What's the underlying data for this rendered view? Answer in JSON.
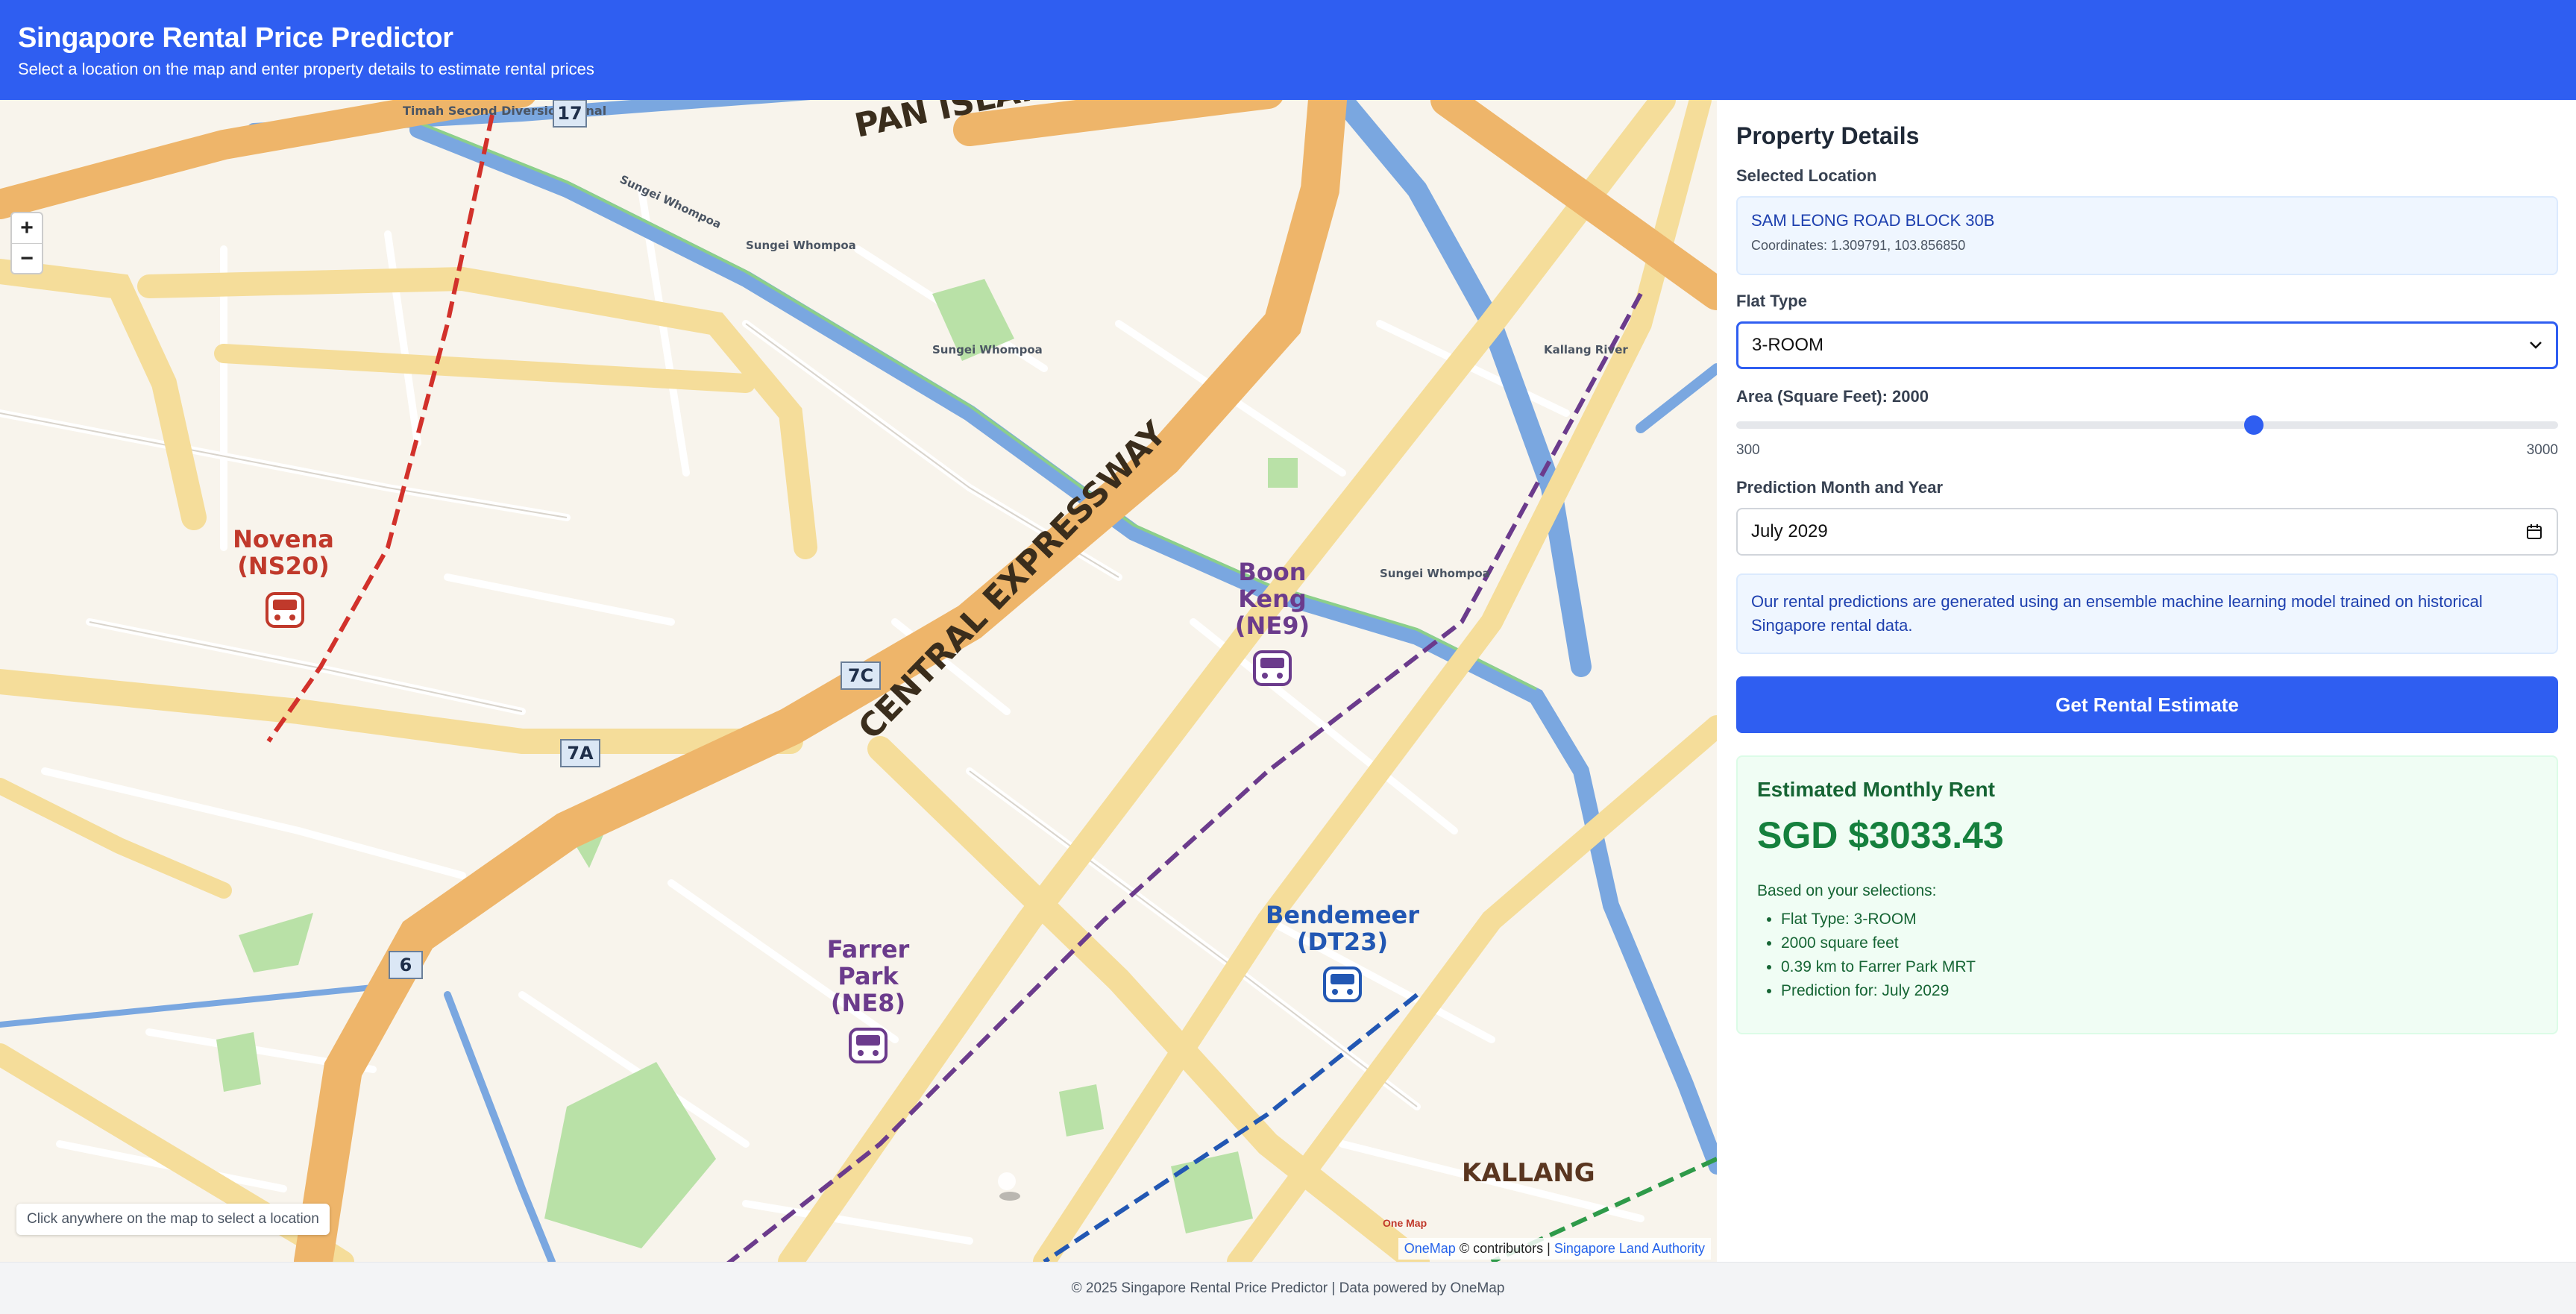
{
  "header": {
    "title": "Singapore Rental Price Predictor",
    "subtitle": "Select a location on the map and enter property details to estimate rental prices"
  },
  "map": {
    "zoom_in": "+",
    "zoom_out": "−",
    "hint": "Click anywhere on the map to select a location",
    "attribution": {
      "onemap": "OneMap",
      "contributors": "© contributors |",
      "sla": "Singapore Land Authority"
    },
    "logo": "One Map",
    "labels": {
      "pan_island": "PAN ISLAND EXP",
      "cte": "CENTRAL EXPRESSWAY",
      "kallang": "KALLANG",
      "timah": "Timah Second Diversion Canal",
      "sungei1": "Sungei Whompoa",
      "sungei2": "Sungei Whompoa",
      "sungei3": "Sungei Whompoa",
      "sungei4": "Sungei Whompoa",
      "kallang_river": "Kallang River",
      "novena": "Novena",
      "novena_code": "(NS20)",
      "boon": "Boon",
      "keng": "Keng",
      "boonkeng_code": "(NE9)",
      "farrer": "Farrer",
      "park": "Park",
      "farrer_code": "(NE8)",
      "bendemeer": "Bendemeer",
      "bendemeer_code": "(DT23)",
      "exit_17": "17",
      "exit_7c": "7C",
      "exit_7a": "7A",
      "exit_6": "6"
    },
    "colors": {
      "expressway": "#eeb56a",
      "major_road": "#f5dd9a",
      "river": "#7aa7e0",
      "park": "#b9e1a7",
      "ns_line": "#d2312b",
      "ne_line": "#6b3b8c",
      "dt_line": "#2257b3"
    }
  },
  "panel": {
    "title": "Property Details",
    "location_label": "Selected Location",
    "location_name": "SAM LEONG ROAD BLOCK 30B",
    "coordinates": "Coordinates: 1.309791, 103.856850",
    "flat_type_label": "Flat Type",
    "flat_type_value": "3-ROOM",
    "area_label": "Area (Square Feet): 2000",
    "area_value": 2000,
    "area_min": "300",
    "area_max": "3000",
    "month_label": "Prediction Month and Year",
    "month_value": "July 2029",
    "info": "Our rental predictions are generated using an ensemble machine learning model trained on historical Singapore rental data.",
    "button": "Get Rental Estimate",
    "accent": "#2f5ef1"
  },
  "result": {
    "title": "Estimated Monthly Rent",
    "price": "SGD $3033.43",
    "basis": "Based on your selections:",
    "items": [
      "Flat Type: 3-ROOM",
      "2000 square feet",
      "0.39 km to Farrer Park MRT",
      "Prediction for: July 2029"
    ]
  },
  "footer": {
    "text": "© 2025 Singapore Rental Price Predictor | Data powered by OneMap"
  }
}
